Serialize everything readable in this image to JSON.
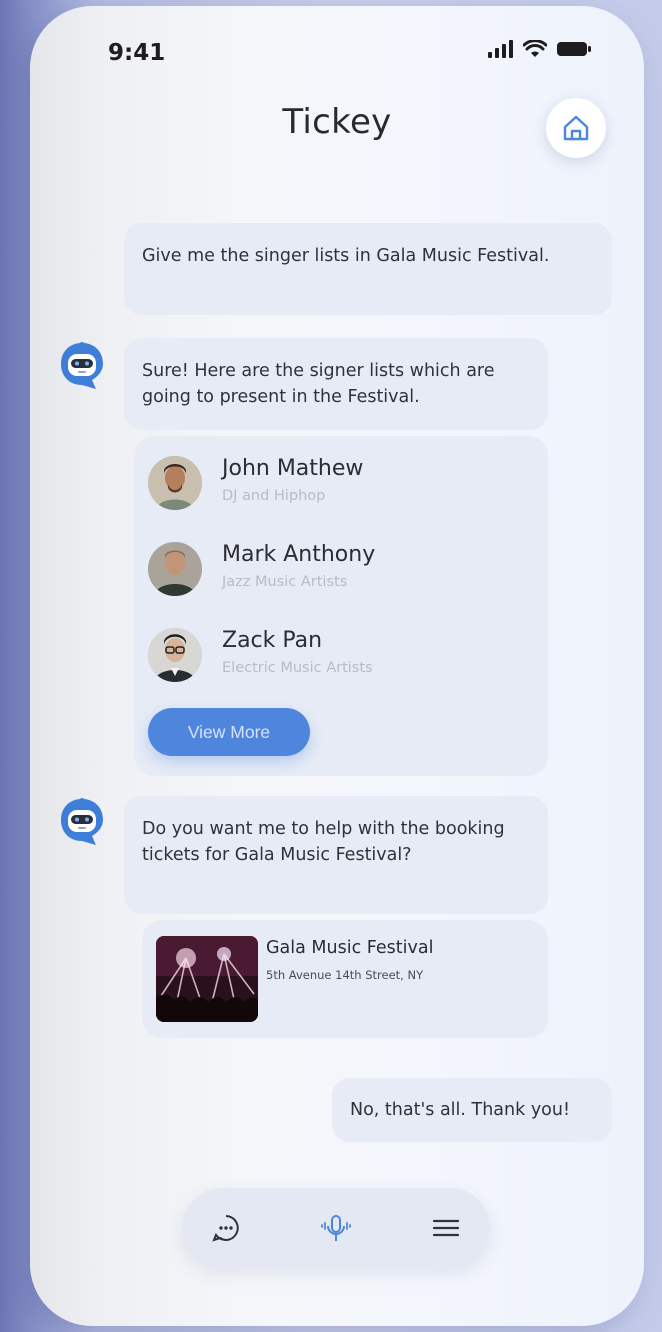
{
  "status_bar": {
    "time": "9:41",
    "icons": [
      "signal-icon",
      "wifi-icon",
      "battery-icon"
    ]
  },
  "header": {
    "title": "Tickey",
    "home_icon": "home-icon"
  },
  "messages": [
    {
      "from": "user",
      "text": "Give me the singer lists in Gala Music Festival."
    },
    {
      "from": "bot",
      "text": "Sure! Here are the signer lists which are going to present in the Festival."
    },
    {
      "from": "bot",
      "text": "Do you want me to help with the booking tickets for Gala Music Festival?"
    },
    {
      "from": "user",
      "text": "No, that's all. Thank you!"
    }
  ],
  "singers": [
    {
      "name": "John Mathew",
      "genre": "DJ and Hiphop"
    },
    {
      "name": "Mark Anthony",
      "genre": "Jazz Music Artists"
    },
    {
      "name": "Zack Pan",
      "genre": "Electric Music Artists"
    }
  ],
  "view_more_label": "View More",
  "event": {
    "name": "Gala Music Festival",
    "address": "5th Avenue 14th Street, NY"
  },
  "bottom_nav": [
    "chat-icon",
    "microphone-icon",
    "menu-icon"
  ],
  "colors": {
    "accent": "#4e86de",
    "bubble": "#e7ebf5",
    "background": "#c9cfec"
  }
}
